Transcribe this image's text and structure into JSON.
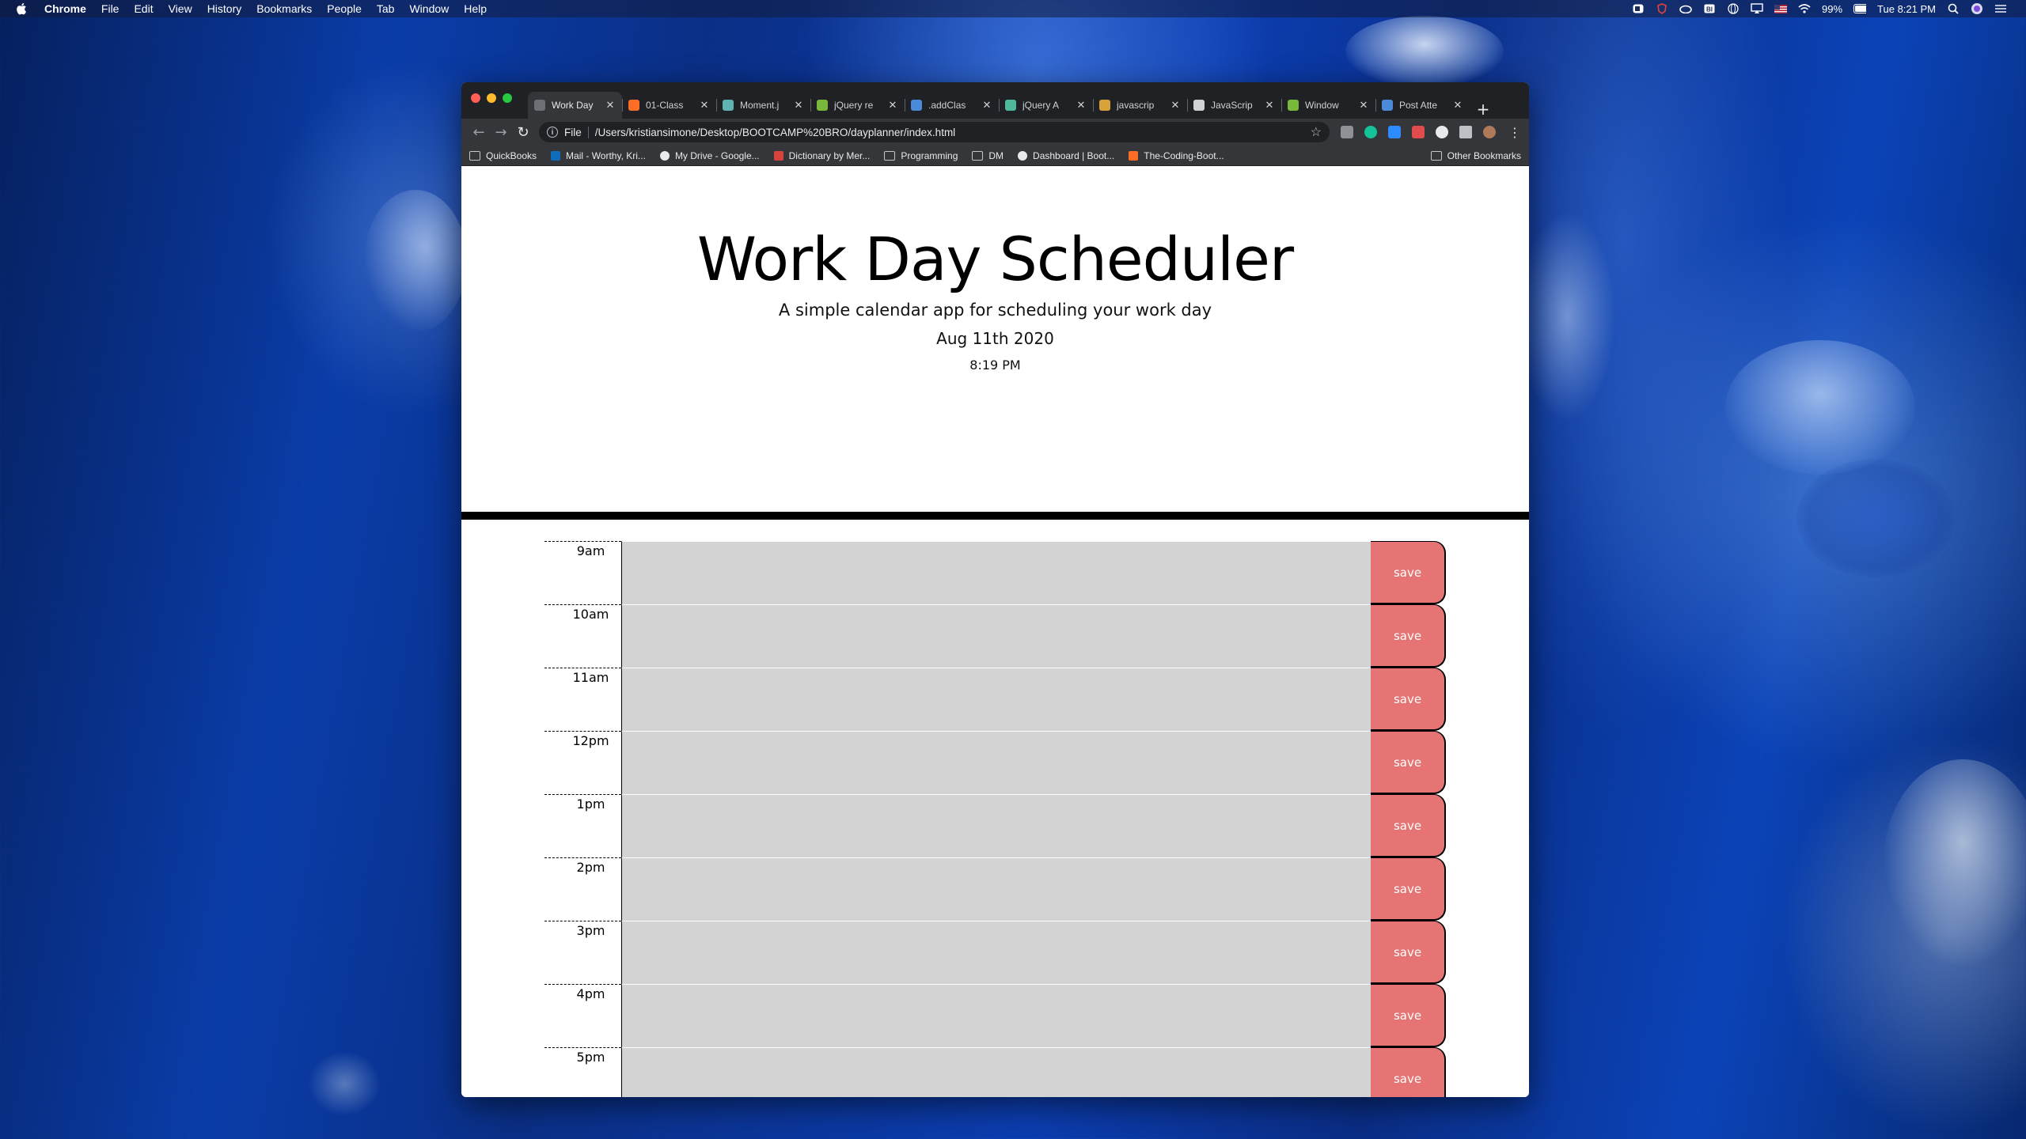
{
  "menubar": {
    "items": [
      "Chrome",
      "File",
      "Edit",
      "View",
      "History",
      "Bookmarks",
      "People",
      "Tab",
      "Window",
      "Help"
    ],
    "battery": "99%",
    "clock": "Tue 8:21 PM"
  },
  "browser": {
    "tabs": [
      {
        "title": "Work Day",
        "active": true,
        "icon_color": "#6c6f73"
      },
      {
        "title": "01-Class",
        "active": false,
        "icon_color": "#fc6d26"
      },
      {
        "title": "Moment.j",
        "active": false,
        "icon_color": "#5fb3b3"
      },
      {
        "title": "jQuery re",
        "active": false,
        "icon_color": "#78b83a"
      },
      {
        "title": ".addClas",
        "active": false,
        "icon_color": "#4a8ad8"
      },
      {
        "title": "jQuery A",
        "active": false,
        "icon_color": "#4fb89a"
      },
      {
        "title": "javascrip",
        "active": false,
        "icon_color": "#d8a23a"
      },
      {
        "title": "JavaScrip",
        "active": false,
        "icon_color": "#d0d3d6"
      },
      {
        "title": "Window",
        "active": false,
        "icon_color": "#78b83a"
      },
      {
        "title": "Post Atte",
        "active": false,
        "icon_color": "#4a8ad8"
      }
    ],
    "scheme": "File",
    "url": "/Users/kristiansimone/Desktop/BOOTCAMP%20BRO/dayplanner/index.html",
    "bookmarks": [
      {
        "label": "QuickBooks",
        "type": "folder"
      },
      {
        "label": "Mail - Worthy, Kri...",
        "type": "outlook"
      },
      {
        "label": "My Drive - Google...",
        "type": "site"
      },
      {
        "label": "Dictionary by Mer...",
        "type": "mw"
      },
      {
        "label": "Programming",
        "type": "folder"
      },
      {
        "label": "DM",
        "type": "folder"
      },
      {
        "label": "Dashboard | Boot...",
        "type": "site"
      },
      {
        "label": "The-Coding-Boot...",
        "type": "gitlab"
      }
    ],
    "other_bookmarks": "Other Bookmarks"
  },
  "page": {
    "title": "Work Day Scheduler",
    "subtitle": "A simple calendar app for scheduling your work day",
    "current_date": "Aug 11th 2020",
    "current_time": "8:19 PM",
    "save_label": "save",
    "hours": [
      "9am",
      "10am",
      "11am",
      "12pm",
      "1pm",
      "2pm",
      "3pm",
      "4pm",
      "5pm"
    ],
    "block_color": "#d3d3d3",
    "save_color": "#e77474"
  }
}
